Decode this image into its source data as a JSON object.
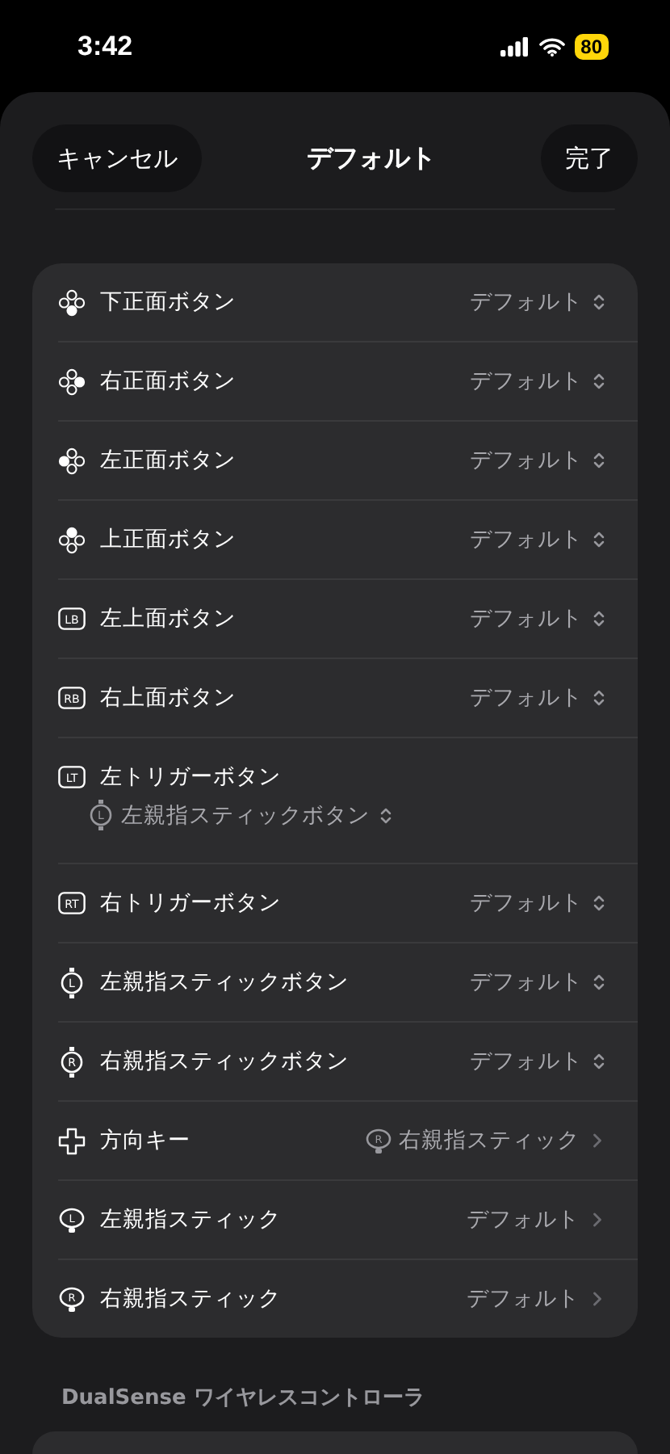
{
  "status_bar": {
    "time": "3:42",
    "battery": "80"
  },
  "header": {
    "cancel": "キャンセル",
    "title": "デフォルト",
    "done": "完了"
  },
  "rows": [
    {
      "kind": "popup",
      "label": "下正面ボタン",
      "icon": {
        "kind": "face_bottom"
      },
      "value": "デフォルト"
    },
    {
      "kind": "popup",
      "label": "右正面ボタン",
      "icon": {
        "kind": "face_right"
      },
      "value": "デフォルト"
    },
    {
      "kind": "popup",
      "label": "左正面ボタン",
      "icon": {
        "kind": "face_left"
      },
      "value": "デフォルト"
    },
    {
      "kind": "popup",
      "label": "上正面ボタン",
      "icon": {
        "kind": "face_top"
      },
      "value": "デフォルト"
    },
    {
      "kind": "popup",
      "label": "左上面ボタン",
      "icon": {
        "kind": "badge",
        "text": "LB"
      },
      "value": "デフォルト"
    },
    {
      "kind": "popup",
      "label": "右上面ボタン",
      "icon": {
        "kind": "badge",
        "text": "RB"
      },
      "value": "デフォルト"
    },
    {
      "kind": "popup_below",
      "label": "左トリガーボタン",
      "icon": {
        "kind": "badge",
        "text": "LT"
      },
      "value": "左親指スティックボタン",
      "value_icon": {
        "kind": "stick_button",
        "text": "L"
      }
    },
    {
      "kind": "popup",
      "label": "右トリガーボタン",
      "icon": {
        "kind": "badge",
        "text": "RT"
      },
      "value": "デフォルト"
    },
    {
      "kind": "popup",
      "label": "左親指スティックボタン",
      "icon": {
        "kind": "stick_button",
        "text": "L"
      },
      "value": "デフォルト"
    },
    {
      "kind": "popup",
      "label": "右親指スティックボタン",
      "icon": {
        "kind": "stick_button",
        "text": "R"
      },
      "value": "デフォルト"
    },
    {
      "kind": "link",
      "label": "方向キー",
      "icon": {
        "kind": "dpad"
      },
      "value": "右親指スティック",
      "value_icon": {
        "kind": "stick",
        "text": "R"
      }
    },
    {
      "kind": "link",
      "label": "左親指スティック",
      "icon": {
        "kind": "stick",
        "text": "L"
      },
      "value": "デフォルト"
    },
    {
      "kind": "link",
      "label": "右親指スティック",
      "icon": {
        "kind": "stick",
        "text": "R"
      },
      "value": "デフォルト"
    }
  ],
  "next_section": {
    "title": "DualSense ワイヤレスコントローラ"
  }
}
